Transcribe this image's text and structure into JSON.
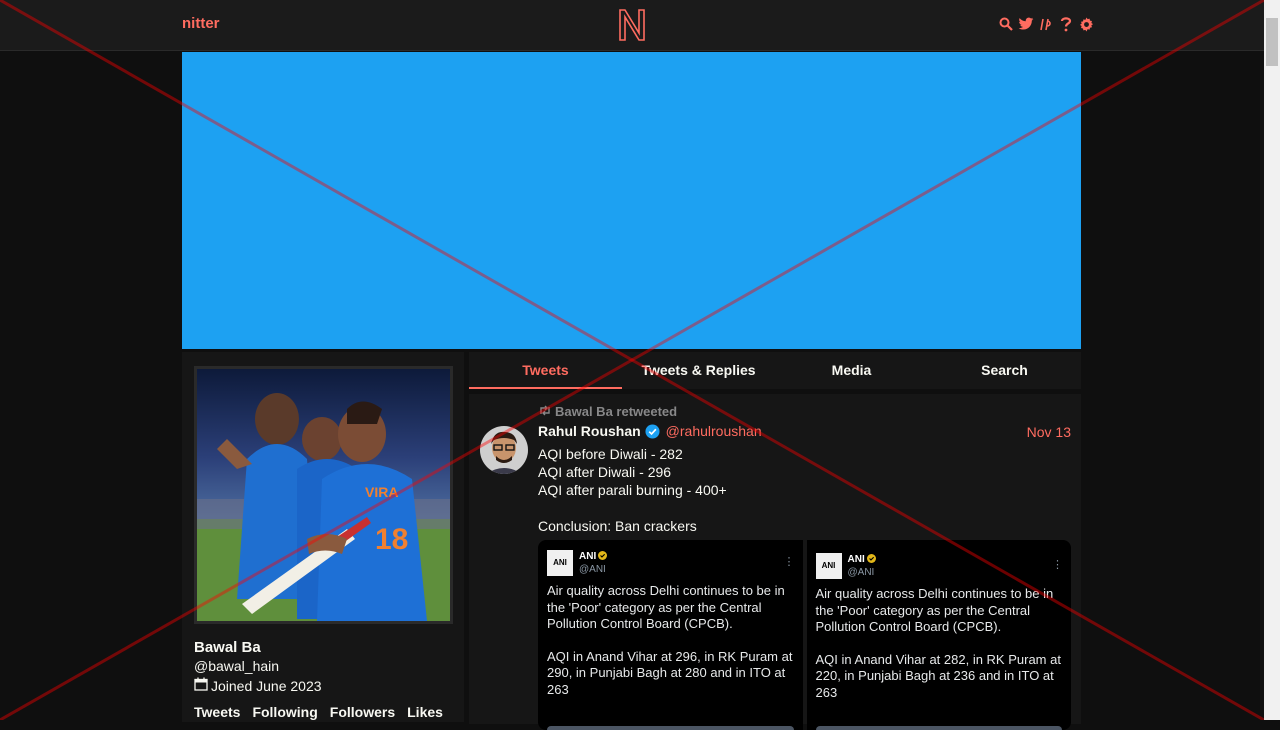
{
  "nav": {
    "brand": "nitter",
    "logo_letter": "N",
    "icons": [
      "search-icon",
      "twitter-bird-icon",
      "rss-icon",
      "help-icon",
      "settings-gear-icon"
    ]
  },
  "colors": {
    "accent": "#ff6c60",
    "banner": "#1da1f2",
    "background": "#0f0f0f",
    "panel": "#161616"
  },
  "profile": {
    "fullname": "Bawal Ba",
    "handle": "@bawal_hain",
    "joined": "Joined June 2023",
    "stats": [
      "Tweets",
      "Following",
      "Followers",
      "Likes"
    ]
  },
  "tabs": [
    {
      "label": "Tweets",
      "active": true
    },
    {
      "label": "Tweets & Replies",
      "active": false
    },
    {
      "label": "Media",
      "active": false
    },
    {
      "label": "Search",
      "active": false
    }
  ],
  "tweet": {
    "retweet_header": "Bawal Ba retweeted",
    "fullname": "Rahul Roushan",
    "username": "@rahulroushan",
    "date": "Nov 13",
    "lines": [
      "AQI before Diwali - 282",
      "AQI after Diwali - 296",
      "AQI after parali burning - 400+",
      "",
      "Conclusion: Ban crackers"
    ],
    "embeds": [
      {
        "name": "ANI",
        "handle": "@ANI",
        "avatar_text": "ANI",
        "para1": "Air quality across Delhi continues to be in the 'Poor' category as per the Central Pollution Control Board (CPCB).",
        "para2": "AQI in Anand Vihar at 296, in RK Puram at 290, in Punjabi Bagh at 280 and in ITO at 263"
      },
      {
        "name": "ANI",
        "handle": "@ANI",
        "avatar_text": "ANI",
        "para1": "Air quality across Delhi continues to be in the 'Poor' category as per the Central Pollution Control Board (CPCB).",
        "para2": "AQI in Anand Vihar at 282, in RK Puram at 220, in Punjabi Bagh at 236 and in ITO at 263"
      }
    ]
  }
}
